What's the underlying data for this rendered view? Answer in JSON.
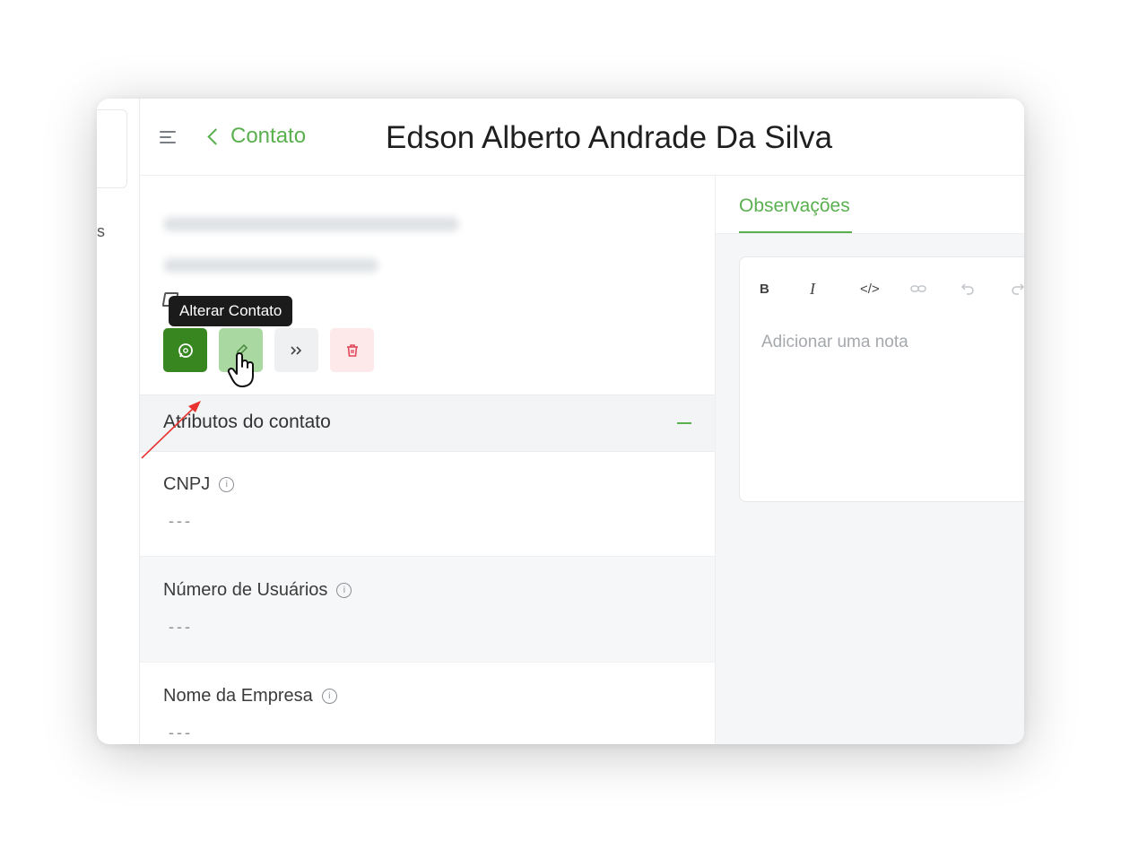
{
  "header": {
    "back_label": "Contato",
    "title": "Edson Alberto Andrade Da Silva"
  },
  "left_strip": {
    "fragment": "s"
  },
  "tooltip": {
    "text": "Alterar Contato"
  },
  "actions": {
    "buttons": [
      "whatsapp",
      "edit",
      "merge",
      "delete"
    ],
    "colors": {
      "whatsapp": "#37861f",
      "edit": "#a9d9a0",
      "merge": "#eef0f2",
      "delete": "#fde8ea"
    }
  },
  "attributes": {
    "section_title": "Atributos do contato",
    "items": [
      {
        "label": "CNPJ",
        "value": "---"
      },
      {
        "label": "Número de Usuários",
        "value": "---"
      },
      {
        "label": "Nome da Empresa",
        "value": "---"
      }
    ]
  },
  "side": {
    "tab_label": "Observações",
    "toolbar": {
      "bold": "B",
      "italic": "I",
      "code": "</>"
    },
    "placeholder": "Adicionar uma nota"
  },
  "colors": {
    "accent": "#5ab04f",
    "dark_green": "#37861f",
    "text": "#1f1f1f"
  }
}
